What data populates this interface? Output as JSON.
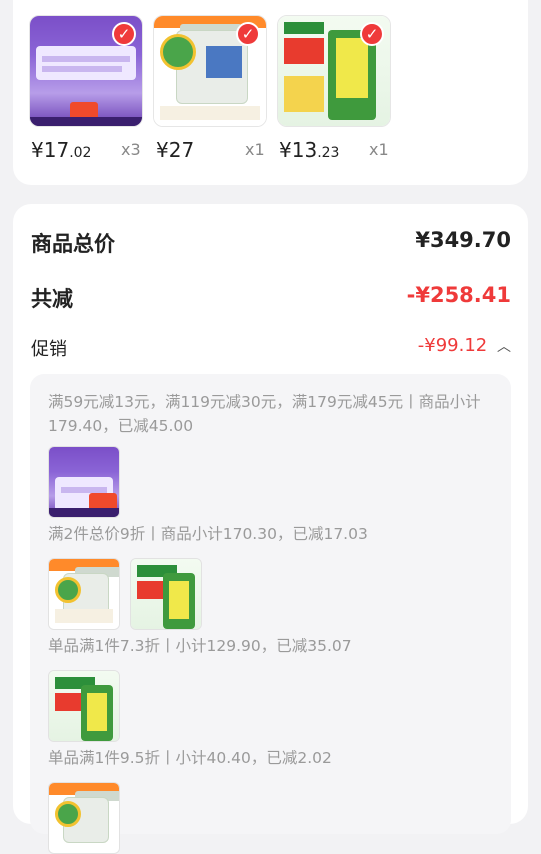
{
  "products": [
    {
      "price_int": "¥17",
      "price_dec": ".02",
      "qty": "x3"
    },
    {
      "price_int": "¥27",
      "price_dec": "",
      "qty": "x1"
    },
    {
      "price_int": "¥13",
      "price_dec": ".23",
      "qty": "x1"
    }
  ],
  "summary": {
    "total_label": "商品总价",
    "total_value": "¥349.70",
    "reduce_label": "共减",
    "reduce_value": "-¥258.41",
    "promo_label": "促销",
    "promo_value": "-¥99.12"
  },
  "promo_details": {
    "rule1": "满59元减13元，满119元减30元，满179元减45元丨商品小计179.40，已减45.00",
    "rule2": "满2件总价9折丨商品小计170.30，已减17.03",
    "rule3": "单品满1件7.3折丨小计129.90，已减35.07",
    "rule4": "单品满1件9.5折丨小计40.40，已减2.02"
  },
  "colors": {
    "accent": "#ef3a3a",
    "muted": "#9a9a9a"
  },
  "icons": {
    "selected": "check-icon",
    "collapse": "chevron-up-icon"
  }
}
